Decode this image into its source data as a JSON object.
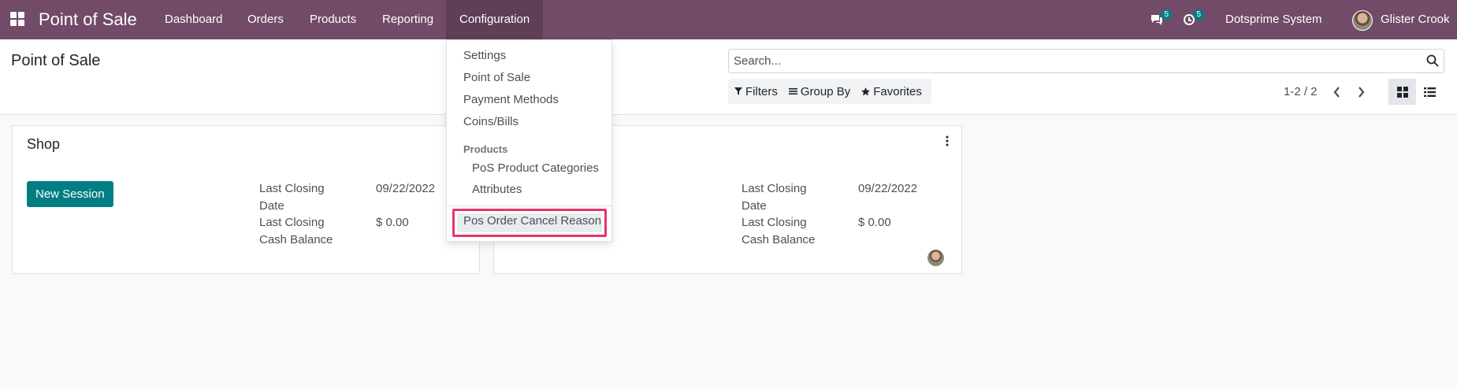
{
  "navbar": {
    "brand": "Point of Sale",
    "menu": [
      "Dashboard",
      "Orders",
      "Products",
      "Reporting",
      "Configuration"
    ],
    "messages_badge": "5",
    "activities_badge": "5",
    "company": "Dotsprime System",
    "user_name": "Glister Crook",
    "bg_color": "#714b67"
  },
  "control": {
    "title": "Point of Sale",
    "search_placeholder": "Search...",
    "filters_label": "Filters",
    "groupby_label": "Group By",
    "favorites_label": "Favorites",
    "pager": "1-2 / 2"
  },
  "cards": [
    {
      "title": "Shop",
      "button_label": "New Session",
      "closing_date_label_1": "Last Closing",
      "closing_date_label_2": "Date",
      "closing_date_value": "09/22/2022",
      "cash_balance_label_1": "Last Closing",
      "cash_balance_label_2": "Cash Balance",
      "cash_balance_value": "$ 0.00"
    },
    {
      "title": "",
      "closing_date_label_1": "Last Closing",
      "closing_date_label_2": "Date",
      "closing_date_value": "09/22/2022",
      "cash_balance_label_1": "Last Closing",
      "cash_balance_label_2": "Cash Balance",
      "cash_balance_value": "$ 0.00"
    }
  ],
  "dropdown": {
    "items": [
      "Settings",
      "Point of Sale",
      "Payment Methods",
      "Coins/Bills"
    ],
    "products_header": "Products",
    "product_items": [
      "PoS Product Categories",
      "Attributes"
    ],
    "highlighted_item": "Pos Order Cancel Reason",
    "highlight_color": "#e6356a"
  },
  "accent_color": "#017e84"
}
